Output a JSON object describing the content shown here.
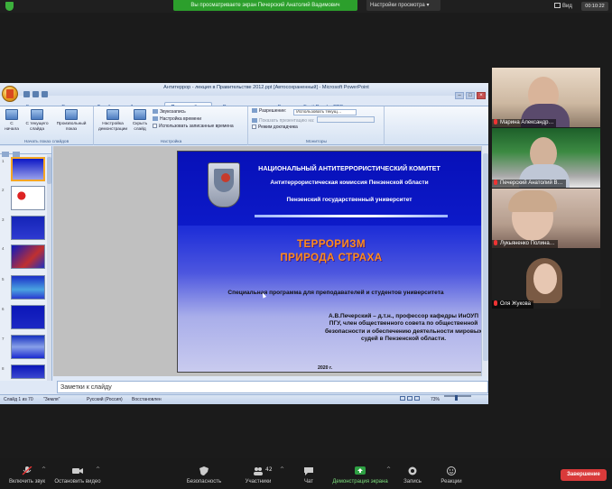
{
  "zoom": {
    "top_bar": {
      "share_banner": "Вы просматриваете экран Печерский Анатолий Вадимович",
      "view_options": "Настройки просмотра",
      "view_button": "Вид",
      "clock": "00:10:22"
    },
    "participants": [
      {
        "name": "Марина Александр…"
      },
      {
        "name": "Печерский Анатолий В…"
      },
      {
        "name": "Лукьяненко Полина…"
      },
      {
        "name": "Оля Жукова"
      }
    ],
    "toolbar": {
      "mute": "Включить звук",
      "video": "Остановить видео",
      "security": "Безопасность",
      "participants": "Участники",
      "participants_count": "42",
      "chat": "Чат",
      "share": "Демонстрация экрана",
      "record": "Запись",
      "reactions": "Реакции",
      "end": "Завершение"
    },
    "colors": {
      "share_green": "#2c9f2c",
      "end_red": "#d93a3a"
    }
  },
  "powerpoint": {
    "title": "Антитеррор - лекция в Правительстве 2012.ppt [Автосохраненный] - Microsoft PowerPoint",
    "tabs": [
      "Главная",
      "Вставка",
      "Дизайн",
      "Анимация",
      "Показ слайдов",
      "Рецензирование",
      "Вид",
      "Foxit Reader PDF"
    ],
    "active_tab": "Показ слайдов",
    "ribbon": {
      "btn_from_start": "С начала",
      "btn_from_current": "С текущего слайда",
      "btn_custom": "Произвольный показ",
      "group_start": "Начать показ слайдов",
      "btn_setup": "Настройка демонстрации",
      "btn_hide": "Скрыть слайд",
      "small_narration": "Звукозапись",
      "small_timings": "Настройка времени",
      "small_use_timings": "Использовать записанные времена",
      "group_setup": "Настройка",
      "small_resolution": "Разрешение:",
      "resolution_value": "Использовать текущ…",
      "small_show_on": "Показать презентацию на:",
      "small_presenter": "Режим докладчика",
      "group_monitors": "Мониторы"
    },
    "notes_placeholder": "Заметки к слайду",
    "status": {
      "slide_counter": "Слайд 1 из 70",
      "theme": "\"Земля\"",
      "language": "Русский (Россия)",
      "recovered": "Восстановлен",
      "zoom": "73%"
    },
    "slide": {
      "header_line1": "НАЦИОНАЛЬНЫЙ АНТИТЕРРОРИСТИЧЕСКИЙ КОМИТЕТ",
      "header_line2": "Антитеррористическая комиссия Пензенской области",
      "header_line3": "Пензенский государственный университет",
      "main_title_1": "ТЕРРОРИЗМ",
      "main_title_2": "ПРИРОДА СТРАХА",
      "subtitle": "Специальная программа  для преподавателей и студентов университета",
      "author": "А.В.Печерский – д.т.н., профессор кафедры ИнОУП ПГУ, член общественного совета по общественной безопасности и обеспечению деятельности мировых судей в Пензенской области.",
      "year": "2020 г."
    },
    "thumbnail_numbers": [
      "1",
      "2",
      "3",
      "4",
      "5",
      "6",
      "7",
      "8"
    ]
  }
}
